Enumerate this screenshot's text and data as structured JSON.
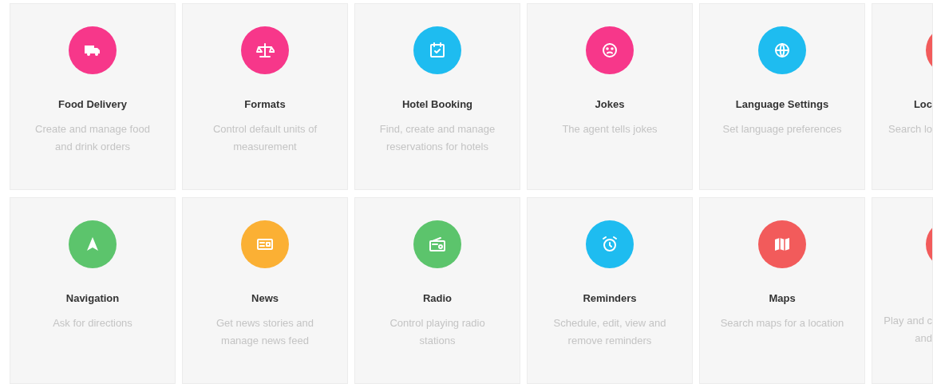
{
  "rows": [
    {
      "cards": [
        {
          "kind": "full",
          "color": "#f7378a",
          "title": "Food Delivery",
          "description": [
            "Create and manage food",
            "and drink orders"
          ]
        },
        {
          "kind": "full",
          "color": "#f7378a",
          "title": "Formats",
          "description": [
            "Control default units of",
            "measurement"
          ]
        },
        {
          "kind": "full",
          "color": "#1ebcf0",
          "title": "Hotel Booking",
          "description": [
            "Find, create and manage",
            "reservations for hotels"
          ]
        },
        {
          "kind": "full",
          "color": "#f7378a",
          "title": "Jokes",
          "description": [
            "The agent tells jokes"
          ]
        },
        {
          "kind": "full",
          "color": "#1ebcf0",
          "title": "Language Settings",
          "description": [
            "Set language preferences"
          ]
        },
        {
          "kind": "cut",
          "color": "#f25b5b",
          "title": "Loc",
          "description": [
            "Search lo"
          ]
        }
      ]
    },
    {
      "cards": [
        {
          "kind": "full",
          "color": "#5cc46c",
          "title": "Navigation",
          "description": [
            "Ask for directions"
          ]
        },
        {
          "kind": "full",
          "color": "#fbb034",
          "title": "News",
          "description": [
            "Get news stories and",
            "manage news feed"
          ]
        },
        {
          "kind": "full",
          "color": "#5cc46c",
          "title": "Radio",
          "description": [
            "Control playing radio",
            "stations"
          ]
        },
        {
          "kind": "full",
          "color": "#1ebcf0",
          "title": "Reminders",
          "description": [
            "Schedule, edit, view and",
            "remove reminders"
          ]
        },
        {
          "kind": "full",
          "color": "#f25b5b",
          "title": "Maps",
          "description": [
            "Search maps for a location"
          ]
        },
        {
          "kind": "cut",
          "color": "#f25b5b",
          "description": [
            "Play and c",
            "and"
          ]
        }
      ]
    }
  ]
}
